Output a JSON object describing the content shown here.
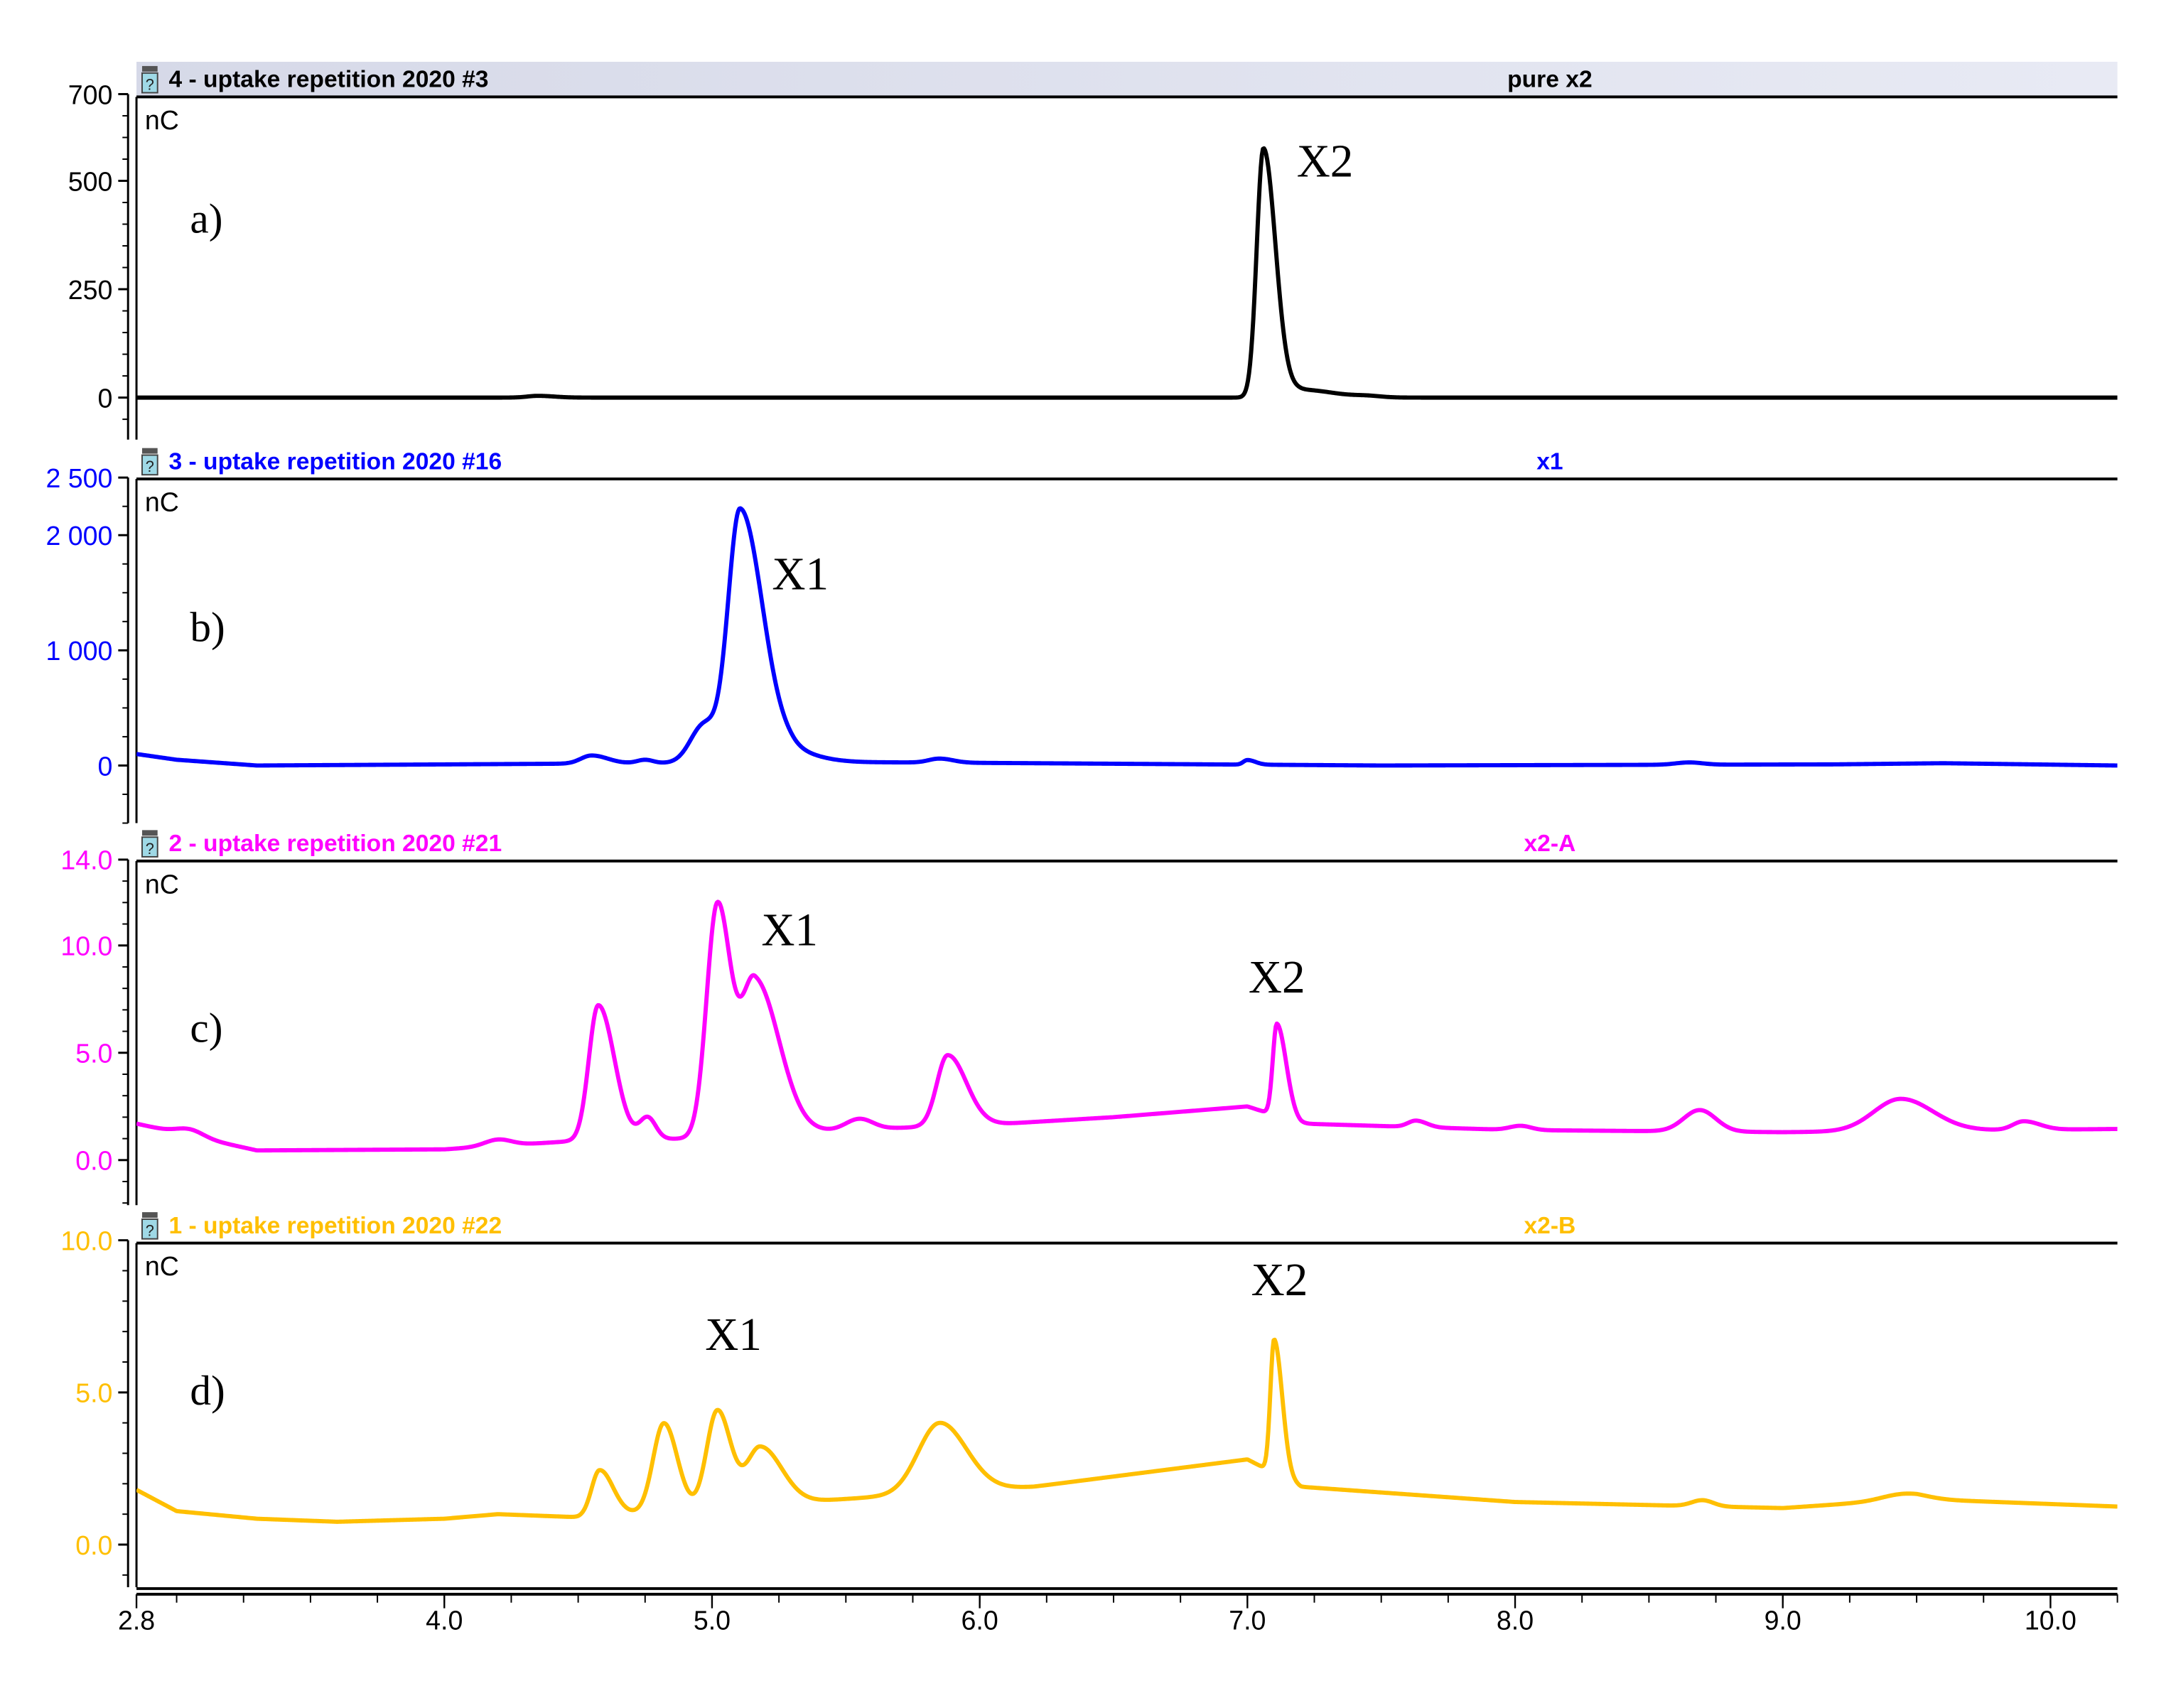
{
  "chart_data": {
    "type": "line",
    "title": "",
    "xlabel": "",
    "xlim": [
      2.85,
      10.25
    ],
    "x_ticks": [
      {
        "value": 2.85,
        "label": "2.8"
      },
      {
        "value": 4.0,
        "label": "4.0"
      },
      {
        "value": 5.0,
        "label": "5.0"
      },
      {
        "value": 6.0,
        "label": "6.0"
      },
      {
        "value": 7.0,
        "label": "7.0"
      },
      {
        "value": 8.0,
        "label": "8.0"
      },
      {
        "value": 9.0,
        "label": "9.0"
      },
      {
        "value": 10.0,
        "label": "10.0"
      }
    ],
    "x_minor_step": 0.25,
    "panels": [
      {
        "id": "a",
        "label": "a)",
        "label_pos": [
          3.05,
          380
        ],
        "header_title": "4 - uptake repetition 2020 #3",
        "header_right": "pure x2",
        "color": "#000000",
        "axis_color": "#000000",
        "unit": "nC",
        "ylim": [
          -97,
          700
        ],
        "y_ticks": [
          {
            "value": 700,
            "label": "700"
          },
          {
            "value": 500,
            "label": "500"
          },
          {
            "value": 250,
            "label": "250"
          },
          {
            "value": 0,
            "label": "0"
          }
        ],
        "y_minor_step": 50,
        "baseline": [
          [
            2.85,
            0
          ],
          [
            10.25,
            0
          ]
        ],
        "peaks": [
          [
            4.35,
            4,
            0.04,
            0.06
          ],
          [
            7.06,
            575,
            0.025,
            0.045
          ],
          [
            7.2,
            18,
            0.05,
            0.12
          ],
          [
            7.45,
            3,
            0.05,
            0.05
          ]
        ],
        "annotations": [
          {
            "text": "X2",
            "t": 7.29,
            "value": 510
          }
        ]
      },
      {
        "id": "b",
        "label": "b)",
        "label_pos": [
          3.05,
          1080
        ],
        "header_title": "3 - uptake repetition 2020 #16",
        "header_right": "x1",
        "color": "#0000ff",
        "axis_color": "#0000ff",
        "unit": "nC",
        "ylim": [
          -500,
          2500
        ],
        "y_ticks": [
          {
            "value": 2500,
            "label": "2 500"
          },
          {
            "value": 2000,
            "label": "2 000"
          },
          {
            "value": 1000,
            "label": "1 000"
          },
          {
            "value": 0,
            "label": "0"
          }
        ],
        "y_minor_step": 250,
        "baseline": [
          [
            2.85,
            100
          ],
          [
            3.0,
            50
          ],
          [
            3.3,
            0
          ],
          [
            5.5,
            30
          ],
          [
            6.2,
            20
          ],
          [
            7.5,
            0
          ],
          [
            9.2,
            10
          ],
          [
            9.6,
            20
          ],
          [
            10.25,
            0
          ]
        ],
        "peaks": [
          [
            4.55,
            70,
            0.04,
            0.06
          ],
          [
            4.75,
            30,
            0.03,
            0.03
          ],
          [
            4.97,
            330,
            0.05,
            0.05
          ],
          [
            5.105,
            2200,
            0.045,
            0.085
          ],
          [
            5.3,
            80,
            0.05,
            0.1
          ],
          [
            5.85,
            35,
            0.04,
            0.05
          ],
          [
            7.0,
            40,
            0.015,
            0.03
          ],
          [
            8.65,
            20,
            0.05,
            0.05
          ]
        ],
        "annotations": [
          {
            "text": "X1",
            "t": 5.33,
            "value": 1530
          }
        ]
      },
      {
        "id": "c",
        "label": "c)",
        "label_pos": [
          3.05,
          5.5
        ],
        "header_title": "2 - uptake repetition 2020 #21",
        "header_right": "x2-A",
        "color": "#ff00ff",
        "axis_color": "#ff00ff",
        "unit": "nC",
        "ylim": [
          -2.1,
          14
        ],
        "y_ticks": [
          {
            "value": 14,
            "label": "14.0"
          },
          {
            "value": 10,
            "label": "10.0"
          },
          {
            "value": 5,
            "label": "5.0"
          },
          {
            "value": 0,
            "label": "0.0"
          }
        ],
        "y_minor_step": 1,
        "baseline": [
          [
            2.85,
            1.7
          ],
          [
            3.1,
            1.0
          ],
          [
            3.3,
            0.45
          ],
          [
            4.0,
            0.5
          ],
          [
            4.5,
            0.9
          ],
          [
            4.9,
            1.0
          ],
          [
            5.5,
            1.4
          ],
          [
            6.1,
            1.7
          ],
          [
            6.5,
            2.0
          ],
          [
            7.0,
            2.5
          ],
          [
            7.2,
            1.7
          ],
          [
            8.0,
            1.4
          ],
          [
            9.0,
            1.3
          ],
          [
            10.25,
            1.45
          ]
        ],
        "peaks": [
          [
            3.05,
            0.3,
            0.05,
            0.05
          ],
          [
            4.2,
            0.3,
            0.05,
            0.05
          ],
          [
            4.575,
            6.3,
            0.035,
            0.06
          ],
          [
            4.76,
            1.0,
            0.03,
            0.03
          ],
          [
            5.02,
            10.8,
            0.04,
            0.05
          ],
          [
            5.16,
            7.2,
            0.05,
            0.09
          ],
          [
            5.55,
            0.5,
            0.05,
            0.05
          ],
          [
            5.88,
            3.3,
            0.04,
            0.07
          ],
          [
            7.11,
            4.3,
            0.015,
            0.035
          ],
          [
            7.63,
            0.3,
            0.03,
            0.04
          ],
          [
            8.02,
            0.2,
            0.04,
            0.04
          ],
          [
            8.69,
            1.0,
            0.06,
            0.06
          ],
          [
            9.44,
            1.5,
            0.1,
            0.12
          ],
          [
            9.9,
            0.4,
            0.04,
            0.06
          ]
        ],
        "annotations": [
          {
            "text": "X1",
            "t": 5.29,
            "value": 10.0
          },
          {
            "text": "X2",
            "t": 7.11,
            "value": 7.8
          }
        ]
      },
      {
        "id": "d",
        "label": "d)",
        "label_pos": [
          3.05,
          4.6
        ],
        "header_title": "1 - uptake repetition 2020 #22",
        "header_right": "x2-B",
        "color": "#ffbf00",
        "axis_color": "#ffbf00",
        "unit": "nC",
        "ylim": [
          -1.4,
          10
        ],
        "y_ticks": [
          {
            "value": 10,
            "label": "10.0"
          },
          {
            "value": 5,
            "label": "5.0"
          },
          {
            "value": 0,
            "label": "0.0"
          }
        ],
        "y_minor_step": 1,
        "baseline": [
          [
            2.85,
            1.8
          ],
          [
            3.0,
            1.1
          ],
          [
            3.3,
            0.85
          ],
          [
            3.6,
            0.75
          ],
          [
            4.0,
            0.85
          ],
          [
            4.2,
            1.0
          ],
          [
            4.5,
            0.9
          ],
          [
            5.5,
            1.5
          ],
          [
            6.2,
            1.9
          ],
          [
            7.0,
            2.8
          ],
          [
            7.2,
            1.9
          ],
          [
            8.0,
            1.4
          ],
          [
            9.0,
            1.2
          ],
          [
            9.5,
            1.5
          ],
          [
            10.25,
            1.25
          ]
        ],
        "peaks": [
          [
            4.58,
            1.5,
            0.03,
            0.05
          ],
          [
            4.82,
            2.9,
            0.04,
            0.05
          ],
          [
            5.02,
            3.2,
            0.04,
            0.05
          ],
          [
            5.18,
            1.9,
            0.05,
            0.08
          ],
          [
            5.85,
            2.3,
            0.08,
            0.1
          ],
          [
            7.1,
            4.4,
            0.014,
            0.03
          ],
          [
            8.7,
            0.2,
            0.04,
            0.04
          ],
          [
            9.45,
            0.2,
            0.08,
            0.08
          ]
        ],
        "annotations": [
          {
            "text": "X1",
            "t": 5.08,
            "value": 6.4
          },
          {
            "text": "X2",
            "t": 7.12,
            "value": 8.2
          }
        ]
      }
    ]
  }
}
